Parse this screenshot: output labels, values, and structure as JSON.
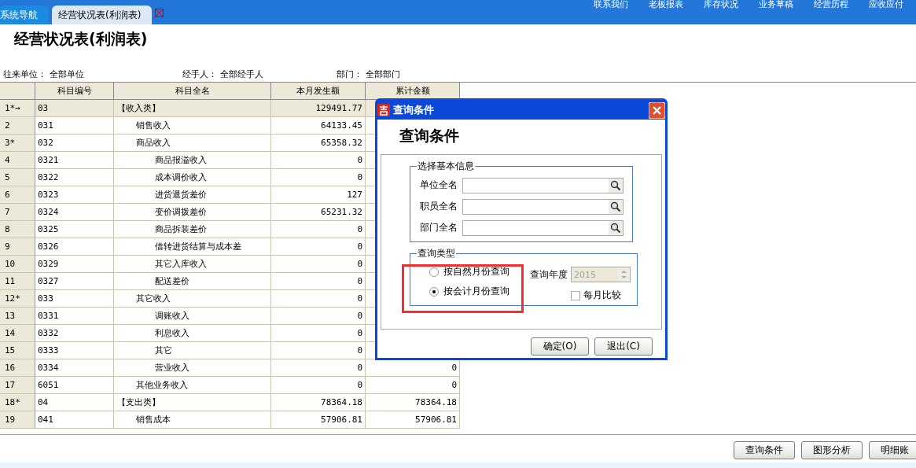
{
  "tabs": [
    {
      "label": "系统导航",
      "selected": false
    },
    {
      "label": "经营状况表(利润表)",
      "selected": true
    }
  ],
  "top_menu": [
    "联系我们",
    "老板报表",
    "库存状况",
    "业务草稿",
    "经营历程",
    "应收应付"
  ],
  "page_title": "经营状况表(利润表)",
  "filters": [
    {
      "label": "往来单位：",
      "value": "全部单位"
    },
    {
      "label": "经手人：",
      "value": "全部经手人"
    },
    {
      "label": "部门：",
      "value": "全部部门"
    }
  ],
  "table": {
    "columns": [
      "科目编号",
      "科目全名",
      "本月发生额",
      "累计金额"
    ],
    "rows": [
      {
        "num": "1*→",
        "code": "03",
        "name": "【收入类】",
        "month": "129491.77",
        "selected": true,
        "children": [
          {
            "num": "2",
            "code": "031",
            "name": "销售收入",
            "month": "64133.45",
            "selected": false
          },
          {
            "num": "3*",
            "code": "032",
            "name": "商品收入",
            "month": "65358.32",
            "selected": false,
            "children": [
              {
                "num": "4",
                "code": "0321",
                "name": "商品报溢收入",
                "month": "0",
                "selected": false
              },
              {
                "num": "5",
                "code": "0322",
                "name": "成本调价收入",
                "month": "0",
                "selected": false
              },
              {
                "num": "6",
                "code": "0323",
                "name": "进货退货差价",
                "month": "127",
                "selected": false
              },
              {
                "num": "7",
                "code": "0324",
                "name": "变价调拨差价",
                "month": "65231.32",
                "selected": false
              },
              {
                "num": "8",
                "code": "0325",
                "name": "商品拆装差价",
                "month": "0",
                "selected": false
              },
              {
                "num": "9",
                "code": "0326",
                "name": "借转进货结算与成本差",
                "month": "0",
                "selected": false
              },
              {
                "num": "10",
                "code": "0329",
                "name": "其它入库收入",
                "month": "0",
                "selected": false
              },
              {
                "num": "11",
                "code": "0327",
                "name": "配送差价",
                "month": "0",
                "selected": false
              }
            ]
          },
          {
            "num": "12*",
            "code": "033",
            "name": "其它收入",
            "month": "0",
            "selected": false,
            "children": [
              {
                "num": "13",
                "code": "0331",
                "name": "调账收入",
                "month": "0",
                "selected": false
              },
              {
                "num": "14",
                "code": "0332",
                "name": "利息收入",
                "month": "0",
                "selected": false
              },
              {
                "num": "15",
                "code": "0333",
                "name": "其它",
                "month": "0",
                "selected": false
              },
              {
                "num": "16",
                "code": "0334",
                "name": "营业收入",
                "month": "0",
                "total": "0",
                "selected": false
              }
            ]
          },
          {
            "num": "17",
            "code": "6051",
            "name": "其他业务收入",
            "month": "0",
            "total": "0",
            "selected": false
          }
        ]
      },
      {
        "num": "18*",
        "code": "04",
        "name": "【支出类】",
        "month": "78364.18",
        "total": "78364.18",
        "selected": false,
        "children": [
          {
            "num": "19",
            "code": "041",
            "name": "销售成本",
            "month": "57906.81",
            "total": "57906.81",
            "selected": false
          }
        ]
      }
    ]
  },
  "bottom_buttons": [
    "查询条件",
    "图形分析",
    "明细账"
  ],
  "dialog": {
    "title": "查询条件",
    "heading": "查询条件",
    "basic_group": {
      "legend": "选择基本信息",
      "fields": [
        {
          "label": "单位全名"
        },
        {
          "label": "职员全名"
        },
        {
          "label": "部门全名"
        }
      ]
    },
    "type_group": {
      "legend": "查询类型",
      "options": [
        {
          "label": "按自然月份查询",
          "selected": false
        },
        {
          "label": "按会计月份查询",
          "selected": true
        }
      ],
      "year": {
        "label": "查询年度",
        "value": "2015",
        "disabled": true
      },
      "compare": {
        "label": "每月比较",
        "checked": false
      }
    },
    "buttons": [
      "确定(O)",
      "退出(C)"
    ]
  }
}
